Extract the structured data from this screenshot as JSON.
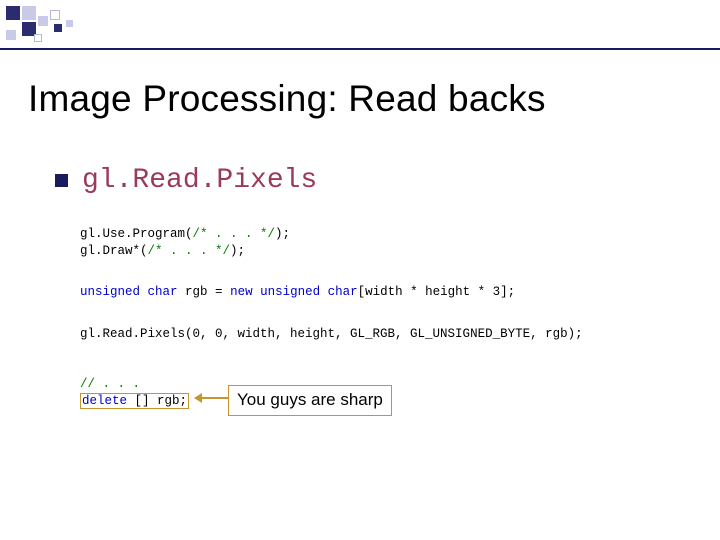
{
  "title": "Image Processing:  Read backs",
  "api_name": "gl.Read.Pixels",
  "code": {
    "line1a": "gl.Use.Program(",
    "line1b": "/* . . . */",
    "line1c": ");",
    "line2a": "gl.Draw*(",
    "line2b": "/* . . . */",
    "line2c": ");",
    "line3a": "unsigned",
    "line3b": " ",
    "line3c": "char",
    "line3d": " rgb = ",
    "line3e": "new",
    "line3f": " ",
    "line3g": "unsigned",
    "line3h": " ",
    "line3i": "char",
    "line3j": "[width * height * 3];",
    "line4": "gl.Read.Pixels(0, 0, width, height, GL_RGB, GL_UNSIGNED_BYTE, rgb);",
    "line5a": "// . . .",
    "line5b": "delete",
    "line5c": " [] rgb;"
  },
  "callout": "You guys are sharp"
}
